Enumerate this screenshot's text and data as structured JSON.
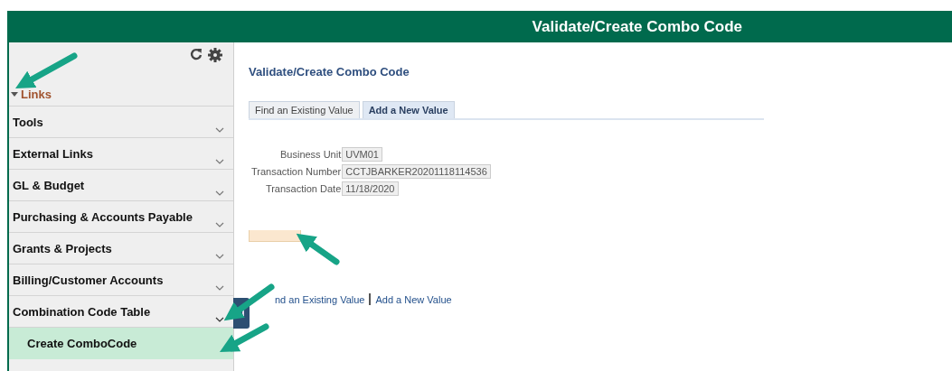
{
  "header": {
    "title": "Validate/Create Combo Code"
  },
  "sidebar": {
    "section": {
      "label": "Links",
      "expanded": true
    },
    "items": [
      {
        "label": "Tools",
        "expanded": false
      },
      {
        "label": "External Links",
        "expanded": false
      },
      {
        "label": "GL & Budget",
        "expanded": false
      },
      {
        "label": "Purchasing & Accounts Payable",
        "expanded": false
      },
      {
        "label": "Grants & Projects",
        "expanded": false
      },
      {
        "label": "Billing/Customer Accounts",
        "expanded": false
      },
      {
        "label": "Combination Code Table",
        "expanded": true,
        "children": [
          {
            "label": "Create ComboCode",
            "selected": true
          }
        ]
      }
    ]
  },
  "page": {
    "title": "Validate/Create Combo Code",
    "tabs": [
      {
        "label": "Find an Existing Value",
        "selected": false
      },
      {
        "label": "Add a New Value",
        "selected": true
      }
    ],
    "fields": [
      {
        "label": "Business Unit",
        "value": "UVM01"
      },
      {
        "label": "Transaction Number",
        "value": "CCTJBARKER20201118114536"
      },
      {
        "label": "Transaction Date",
        "value": "11/18/2020"
      }
    ],
    "links": [
      {
        "label": "nd an Existing Value"
      },
      {
        "label": "Add a New Value"
      }
    ]
  }
}
